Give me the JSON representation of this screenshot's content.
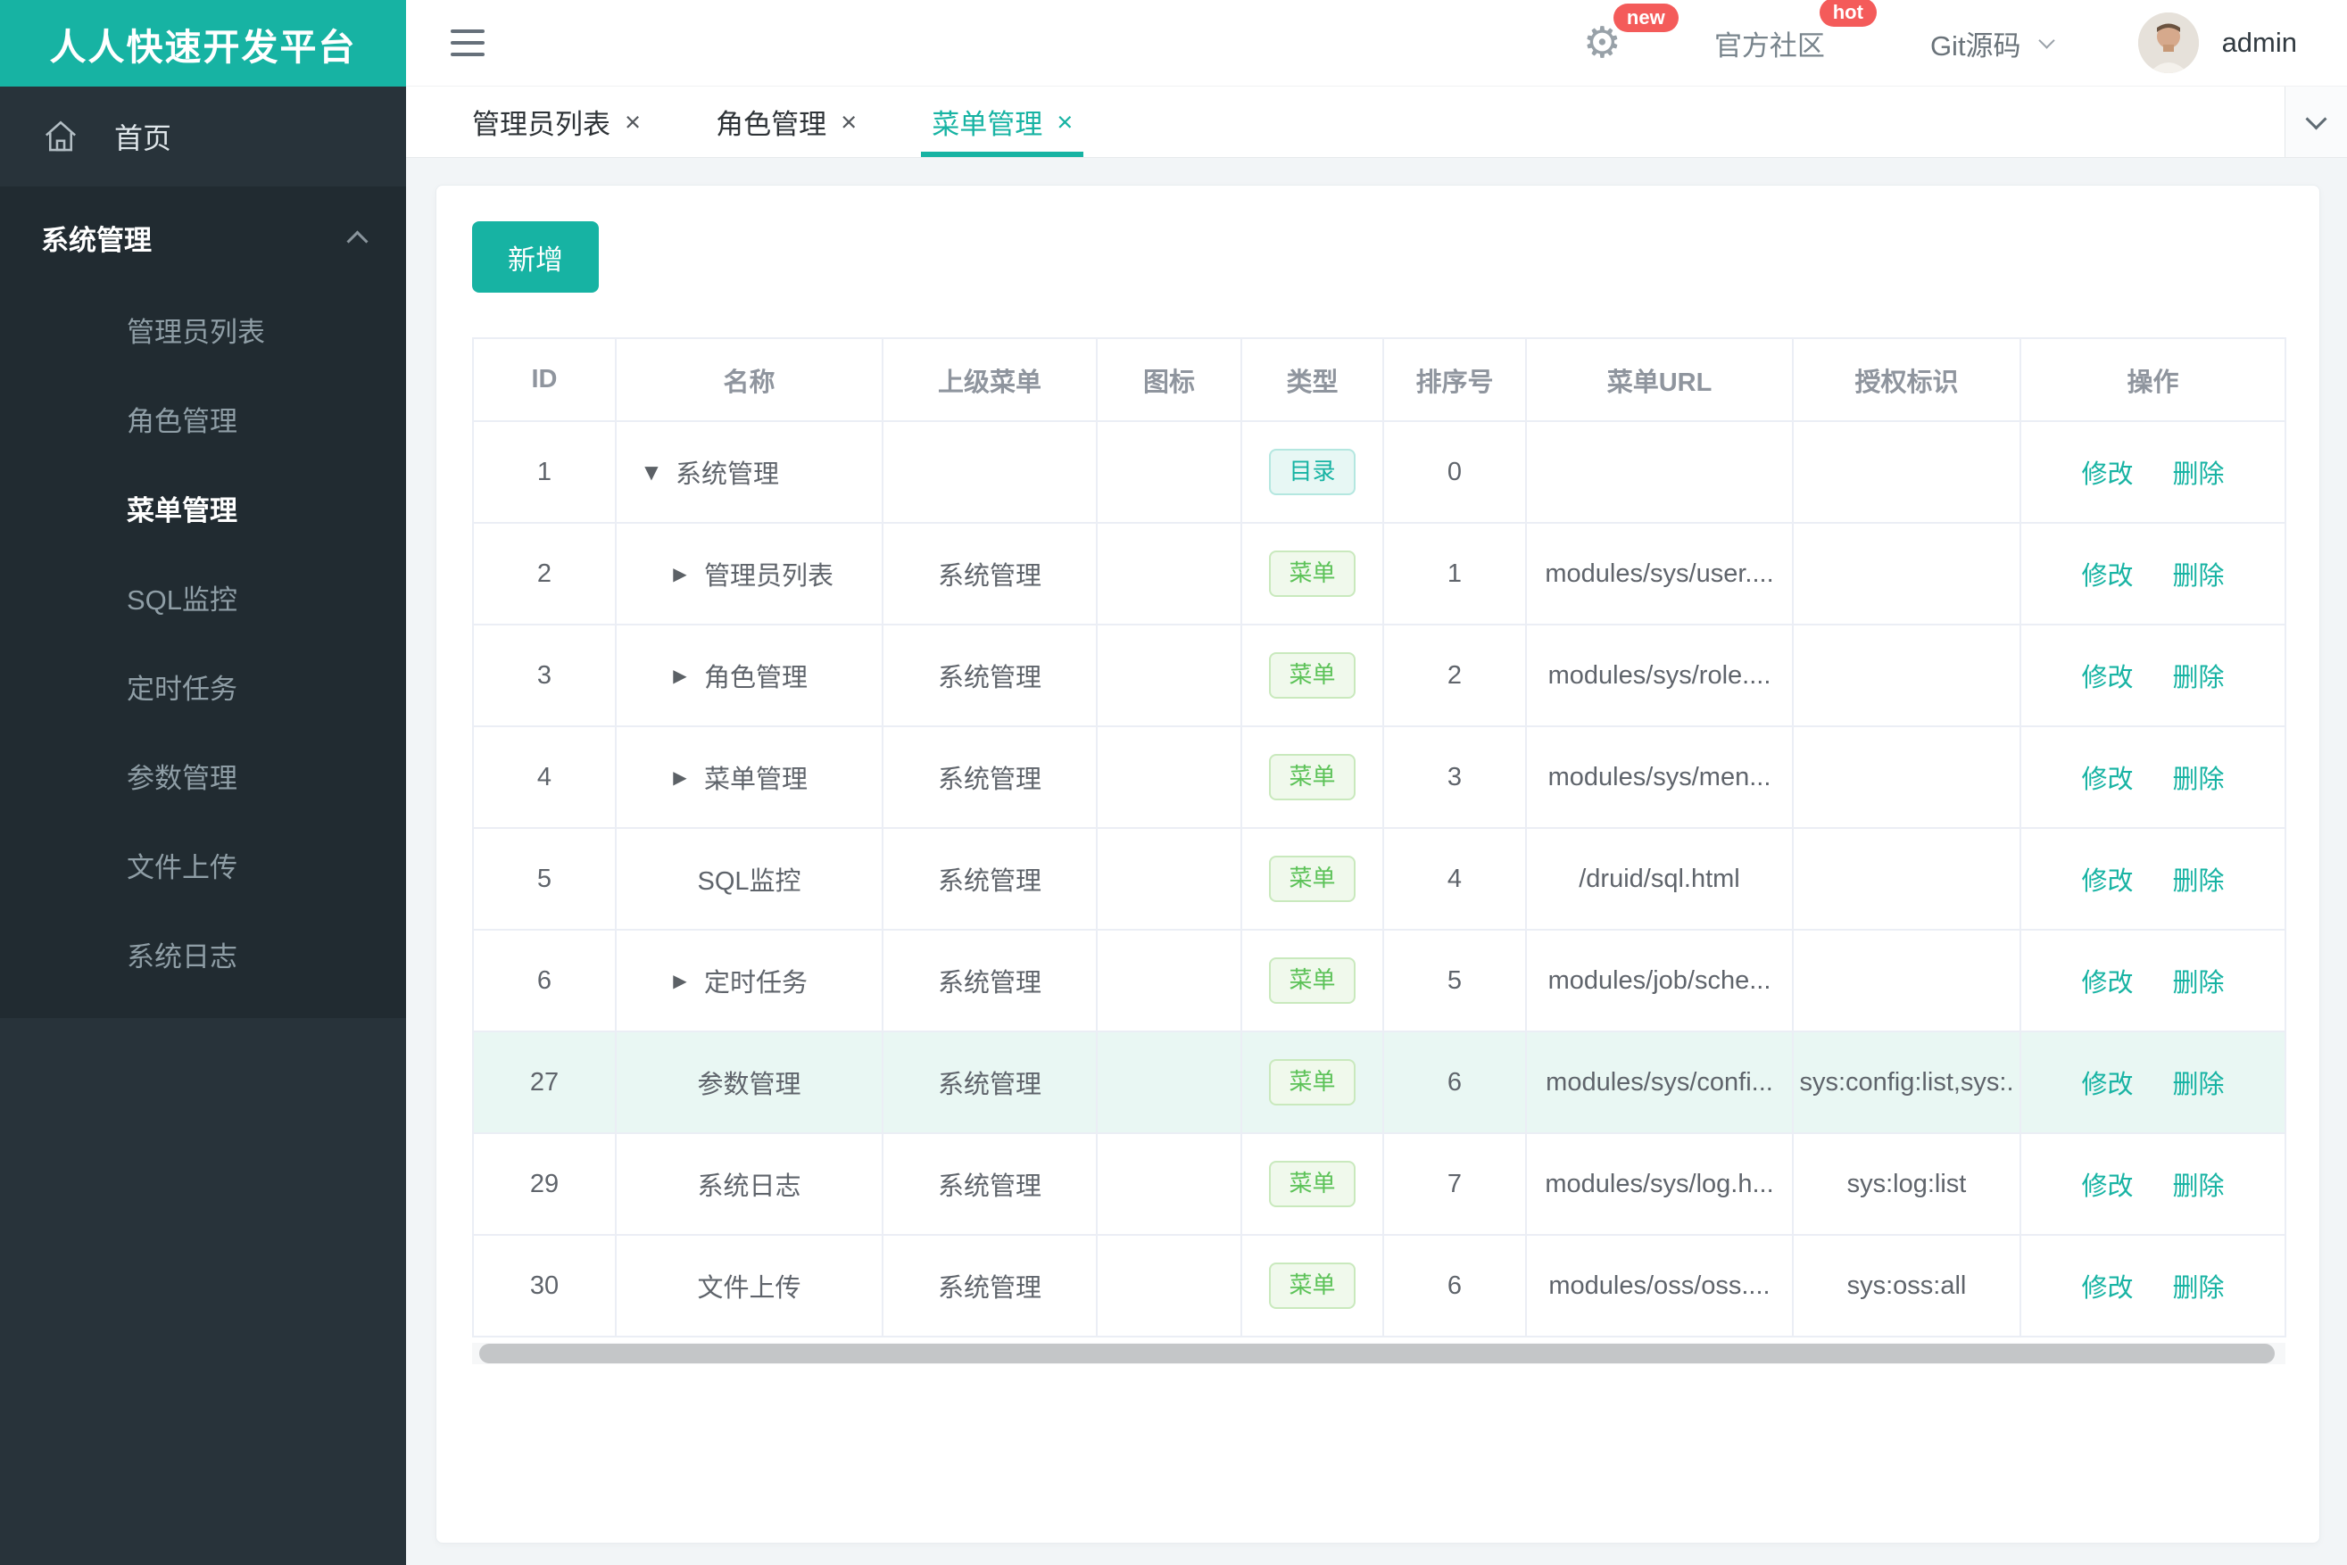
{
  "brand": {
    "title": "人人快速开发平台",
    "accent_color": "#17b3a3"
  },
  "header": {
    "gear_badge": "new",
    "community_label": "官方社区",
    "community_badge": "hot",
    "git_label": "Git源码",
    "user_name": "admin"
  },
  "sidebar": {
    "home_label": "首页",
    "section_label": "系统管理",
    "items": [
      {
        "label": "管理员列表",
        "active": false
      },
      {
        "label": "角色管理",
        "active": false
      },
      {
        "label": "菜单管理",
        "active": true
      },
      {
        "label": "SQL监控",
        "active": false
      },
      {
        "label": "定时任务",
        "active": false
      },
      {
        "label": "参数管理",
        "active": false
      },
      {
        "label": "文件上传",
        "active": false
      },
      {
        "label": "系统日志",
        "active": false
      }
    ]
  },
  "tabs": [
    {
      "label": "管理员列表",
      "active": false
    },
    {
      "label": "角色管理",
      "active": false
    },
    {
      "label": "菜单管理",
      "active": true
    }
  ],
  "toolbar": {
    "add_label": "新增"
  },
  "icons": {
    "close": "×",
    "gear": "⚙",
    "arrow_down": "▼",
    "arrow_right": "▶"
  },
  "table": {
    "columns": [
      "ID",
      "名称",
      "上级菜单",
      "图标",
      "类型",
      "排序号",
      "菜单URL",
      "授权标识",
      "操作"
    ],
    "badge_labels": {
      "dir": "目录",
      "menu": "菜单"
    },
    "action_labels": {
      "modify": "修改",
      "delete": "删除"
    },
    "status_colors": {
      "dir": "#17b3a3",
      "menu": "#5cc258",
      "badge_red": "#f45b5a"
    },
    "rows": [
      {
        "id": "1",
        "name": "系统管理",
        "arrow": "down",
        "level": 0,
        "parent": "",
        "type": "dir",
        "sort": "0",
        "url": "",
        "auth": "",
        "highlight": false
      },
      {
        "id": "2",
        "name": "管理员列表",
        "arrow": "right",
        "level": 1,
        "parent": "系统管理",
        "type": "menu",
        "sort": "1",
        "url": "modules/sys/user....",
        "auth": "",
        "highlight": false
      },
      {
        "id": "3",
        "name": "角色管理",
        "arrow": "right",
        "level": 1,
        "parent": "系统管理",
        "type": "menu",
        "sort": "2",
        "url": "modules/sys/role....",
        "auth": "",
        "highlight": false
      },
      {
        "id": "4",
        "name": "菜单管理",
        "arrow": "right",
        "level": 1,
        "parent": "系统管理",
        "type": "menu",
        "sort": "3",
        "url": "modules/sys/men...",
        "auth": "",
        "highlight": false
      },
      {
        "id": "5",
        "name": "SQL监控",
        "arrow": "",
        "level": null,
        "parent": "系统管理",
        "type": "menu",
        "sort": "4",
        "url": "/druid/sql.html",
        "auth": "",
        "highlight": false
      },
      {
        "id": "6",
        "name": "定时任务",
        "arrow": "right",
        "level": 1,
        "parent": "系统管理",
        "type": "menu",
        "sort": "5",
        "url": "modules/job/sche...",
        "auth": "",
        "highlight": false
      },
      {
        "id": "27",
        "name": "参数管理",
        "arrow": "",
        "level": null,
        "parent": "系统管理",
        "type": "menu",
        "sort": "6",
        "url": "modules/sys/confi...",
        "auth": "sys:config:list,sys:.",
        "highlight": true
      },
      {
        "id": "29",
        "name": "系统日志",
        "arrow": "",
        "level": null,
        "parent": "系统管理",
        "type": "menu",
        "sort": "7",
        "url": "modules/sys/log.h...",
        "auth": "sys:log:list",
        "highlight": false
      },
      {
        "id": "30",
        "name": "文件上传",
        "arrow": "",
        "level": null,
        "parent": "系统管理",
        "type": "menu",
        "sort": "6",
        "url": "modules/oss/oss....",
        "auth": "sys:oss:all",
        "highlight": false
      }
    ]
  }
}
